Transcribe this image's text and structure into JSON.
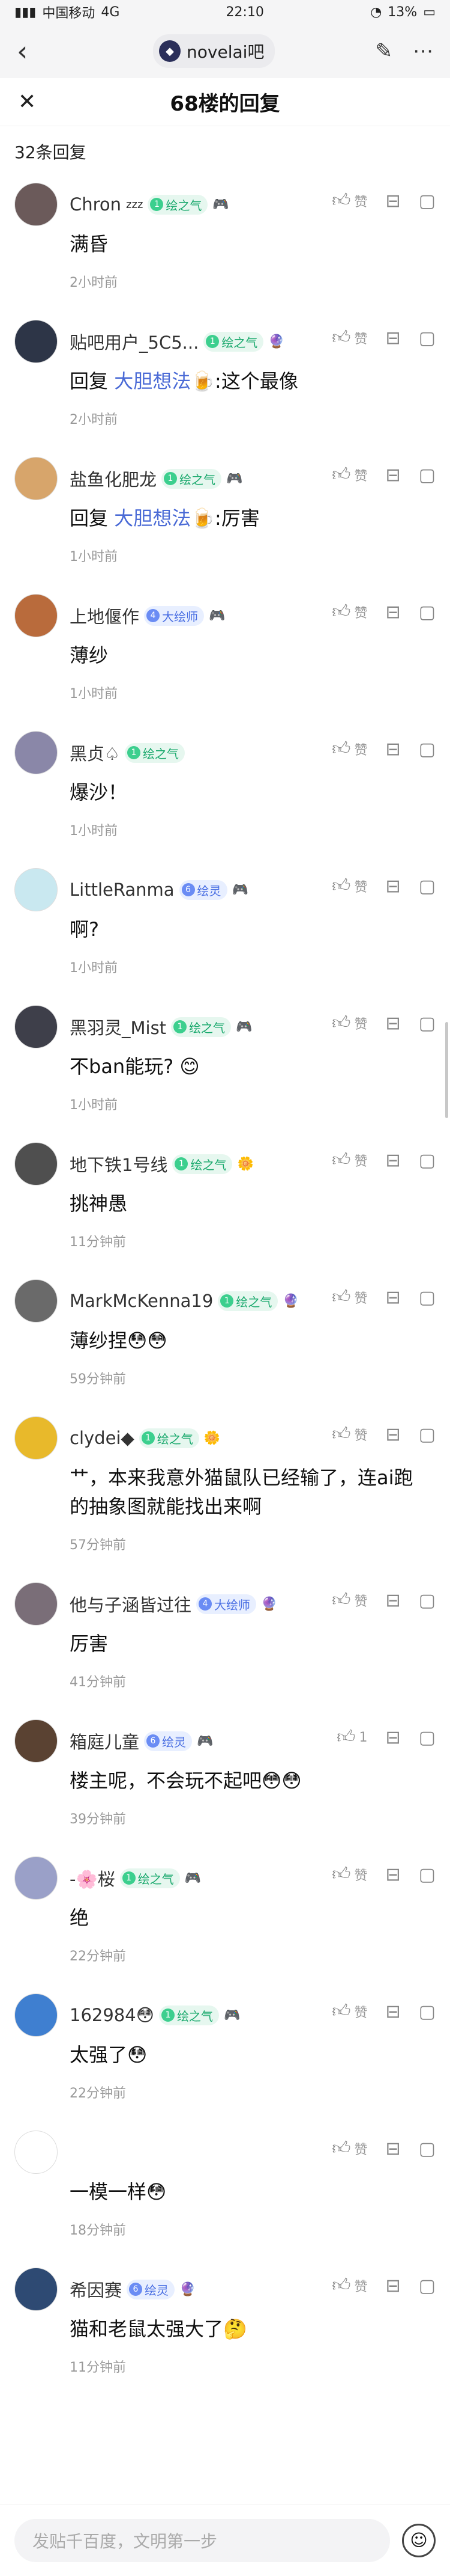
{
  "status_bar": {
    "carrier": "中国移动",
    "network": "4G",
    "time": "22:10",
    "battery": "13%"
  },
  "nav": {
    "forum_name": "novelai吧",
    "back_icon": "back-chevron-icon",
    "edit_icon": "edit-icon",
    "more_icon": "more-icon"
  },
  "sheet": {
    "title": "68楼的回复",
    "close_icon": "close-icon",
    "reply_count": "32条回复"
  },
  "labels": {
    "like": "赞",
    "reply_prefix": "回复"
  },
  "replies": [
    {
      "user": "Chron",
      "user_suffix": "zzz",
      "badge": "绘之气",
      "badge_level": "1",
      "badge_color": "green",
      "deco": "🎮",
      "text": "满昏",
      "time": "2小时前",
      "avatar_color": "#6b5a5a"
    },
    {
      "user": "贴吧用户_5C5...",
      "badge": "绘之气",
      "badge_level": "1",
      "badge_color": "green",
      "deco": "🔮",
      "reply_to": "大胆想法🍺",
      "text": ":这个最像",
      "time": "2小时前",
      "avatar_color": "#2d3547"
    },
    {
      "user": "盐鱼化肥龙",
      "badge": "绘之气",
      "badge_level": "1",
      "badge_color": "green",
      "deco": "🎮",
      "reply_to": "大胆想法🍺",
      "text": ":厉害",
      "time": "1小时前",
      "avatar_color": "#d7a56b"
    },
    {
      "user": "上地偃作",
      "badge": "大绘师",
      "badge_level": "4",
      "badge_color": "blue",
      "deco": "🎮",
      "text": "薄纱",
      "time": "1小时前",
      "avatar_color": "#b96b3c"
    },
    {
      "user": "黑贞♤",
      "badge": "绘之气",
      "badge_level": "1",
      "badge_color": "green",
      "deco": "",
      "text": "爆沙！",
      "time": "1小时前",
      "avatar_color": "#8a87a8"
    },
    {
      "user": "LittleRanma",
      "badge": "绘灵",
      "badge_level": "6",
      "badge_color": "blue",
      "deco": "🎮",
      "text": "啊?",
      "time": "1小时前",
      "avatar_color": "#c9e8f0"
    },
    {
      "user": "黑羽灵_Mist",
      "badge": "绘之气",
      "badge_level": "1",
      "badge_color": "green",
      "deco": "🎮",
      "text": "不ban能玩? 😊",
      "time": "1小时前",
      "avatar_color": "#3e3f4a"
    },
    {
      "user": "地下铁1号线",
      "badge": "绘之气",
      "badge_level": "1",
      "badge_color": "green",
      "deco": "🌼",
      "text": "挑神愚",
      "time": "11分钟前",
      "avatar_color": "#4f4f4f"
    },
    {
      "user": "MarkMcKenna19",
      "badge": "绘之气",
      "badge_level": "1",
      "badge_color": "green",
      "deco": "🔮",
      "text": "薄纱捏😳😳",
      "time": "59分钟前",
      "avatar_color": "#6a6a6a"
    },
    {
      "user": "clydei◆",
      "badge": "绘之气",
      "badge_level": "1",
      "badge_color": "green",
      "deco": "🌼",
      "text": "艹，本来我意外猫鼠队已经输了，连ai跑的抽象图就能找出来啊",
      "time": "57分钟前",
      "avatar_color": "#e8b92b"
    },
    {
      "user": "他与子涵皆过往",
      "badge": "大绘师",
      "badge_level": "4",
      "badge_color": "blue",
      "deco": "🔮",
      "text": "厉害",
      "time": "41分钟前",
      "avatar_color": "#7a6e78"
    },
    {
      "user": "箱庭儿童",
      "badge": "绘灵",
      "badge_level": "6",
      "badge_color": "blue",
      "deco": "🎮",
      "like_count": "1",
      "text": "楼主呢，不会玩不起吧😳😳",
      "time": "39分钟前",
      "avatar_color": "#5a4232"
    },
    {
      "user": "-🌸桜",
      "badge": "绘之气",
      "badge_level": "1",
      "badge_color": "green",
      "deco": "🎮",
      "text": "绝",
      "time": "22分钟前",
      "avatar_color": "#9aa0c8"
    },
    {
      "user": "162984😳",
      "badge": "绘之气",
      "badge_level": "1",
      "badge_color": "green",
      "deco": "🎮",
      "text": "太强了😳",
      "time": "22分钟前",
      "avatar_color": "#3f7fd0"
    },
    {
      "user": "",
      "badge": "",
      "badge_level": "",
      "badge_color": "green",
      "deco": "",
      "text": "一模一样😳",
      "time": "18分钟前",
      "avatar_color": "#ffffff"
    },
    {
      "user": "希因赛",
      "badge": "绘灵",
      "badge_level": "6",
      "badge_color": "blue",
      "deco": "🔮",
      "text": "猫和老鼠太强大了🤔",
      "time": "11分钟前",
      "avatar_color": "#2e4a73"
    }
  ],
  "bottom_bar": {
    "placeholder": "发贴千百度，文明第一步",
    "emoji_icon": "emoji-icon"
  }
}
